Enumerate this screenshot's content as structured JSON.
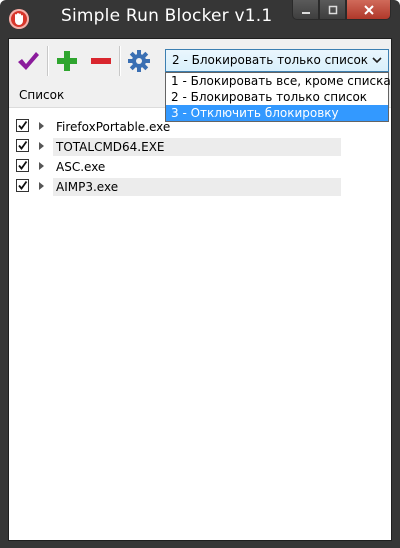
{
  "window": {
    "title": "Simple Run Blocker v1.1",
    "icon": "stop-hand-icon",
    "buttons": {
      "minimize": "minimize-icon",
      "maximize": "maximize-icon",
      "close": "close-icon"
    }
  },
  "toolbar": {
    "icons": [
      "checkmark-icon",
      "plus-icon",
      "minus-icon",
      "gear-icon"
    ],
    "mode_select": {
      "selected": "2 - Блокировать только список",
      "options": [
        "1 - Блокировать все, кроме списка",
        "2 - Блокировать только список",
        "3 - Отключить блокировку"
      ],
      "highlighted_index": 2
    }
  },
  "list": {
    "header": "Список",
    "items": [
      {
        "label": "FirefoxPortable.exe",
        "checked": true
      },
      {
        "label": "TOTALCMD64.EXE",
        "checked": true
      },
      {
        "label": "ASC.exe",
        "checked": true
      },
      {
        "label": "AIMP3.exe",
        "checked": true
      }
    ]
  },
  "colors": {
    "titlebar": "#363636",
    "check": "#8b1c9c",
    "plus": "#2fa52f",
    "minus": "#d9262e",
    "gear": "#3a6fb3",
    "highlight": "#3399ff"
  }
}
